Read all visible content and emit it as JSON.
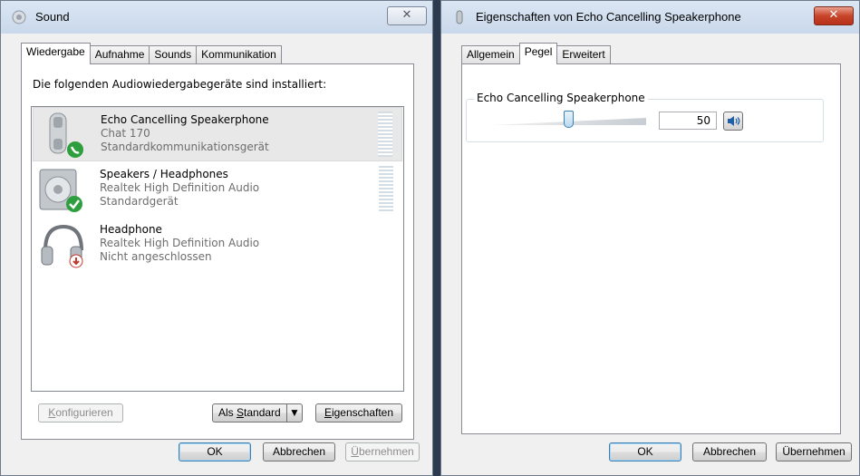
{
  "sound_window": {
    "title": "Sound",
    "close_glyph": "✕",
    "tabs": [
      {
        "label": "Wiedergabe",
        "active": true
      },
      {
        "label": "Aufnahme",
        "active": false
      },
      {
        "label": "Sounds",
        "active": false
      },
      {
        "label": "Kommunikation",
        "active": false
      }
    ],
    "heading": "Die folgenden Audiowiedergabegeräte sind installiert:",
    "devices": [
      {
        "name": "Echo Cancelling Speakerphone",
        "line1": "Chat 170",
        "line2": "Standardkommunikationsgerät",
        "icon": "phone-icon",
        "badge": "phone-badge-icon",
        "selected": true
      },
      {
        "name": "Speakers / Headphones",
        "line1": "Realtek High Definition Audio",
        "line2": "Standardgerät",
        "icon": "speaker-icon",
        "badge": "checkmark-badge-icon",
        "selected": false
      },
      {
        "name": "Headphone",
        "line1": "Realtek High Definition Audio",
        "line2": "Nicht angeschlossen",
        "icon": "headphone-icon",
        "badge": "unplugged-badge-icon",
        "selected": false
      }
    ],
    "buttons": {
      "configure": {
        "label_u": "K",
        "label_rest": "onfigurieren"
      },
      "set_default": {
        "label_pre": "Als ",
        "label_u": "S",
        "label_rest": "tandard"
      },
      "properties": {
        "label_u": "E",
        "label_rest": "igenschaften"
      },
      "ok": "OK",
      "cancel": "Abbrechen",
      "apply": {
        "label_u": "Ü",
        "label_rest": "bernehmen"
      }
    }
  },
  "props_window": {
    "title": "Eigenschaften von Echo Cancelling Speakerphone",
    "close_glyph": "✕",
    "tabs": [
      {
        "label": "Allgemein",
        "active": false
      },
      {
        "label": "Pegel",
        "active": true
      },
      {
        "label": "Erweitert",
        "active": false
      }
    ],
    "level_group": {
      "label": "Echo Cancelling Speakerphone",
      "level_value": "50",
      "slider_fraction": 0.5
    },
    "buttons": {
      "ok": "OK",
      "cancel": "Abbrechen",
      "apply": "Übernehmen"
    }
  },
  "colors": {
    "window_bg": "#f0f0f0",
    "title_bg": "#c9d8eb",
    "selected_row": "#e8e8e8",
    "close_red": "#c7442a",
    "accent_blue": "#3c7fb1",
    "badge_green": "#2e9e3e"
  }
}
